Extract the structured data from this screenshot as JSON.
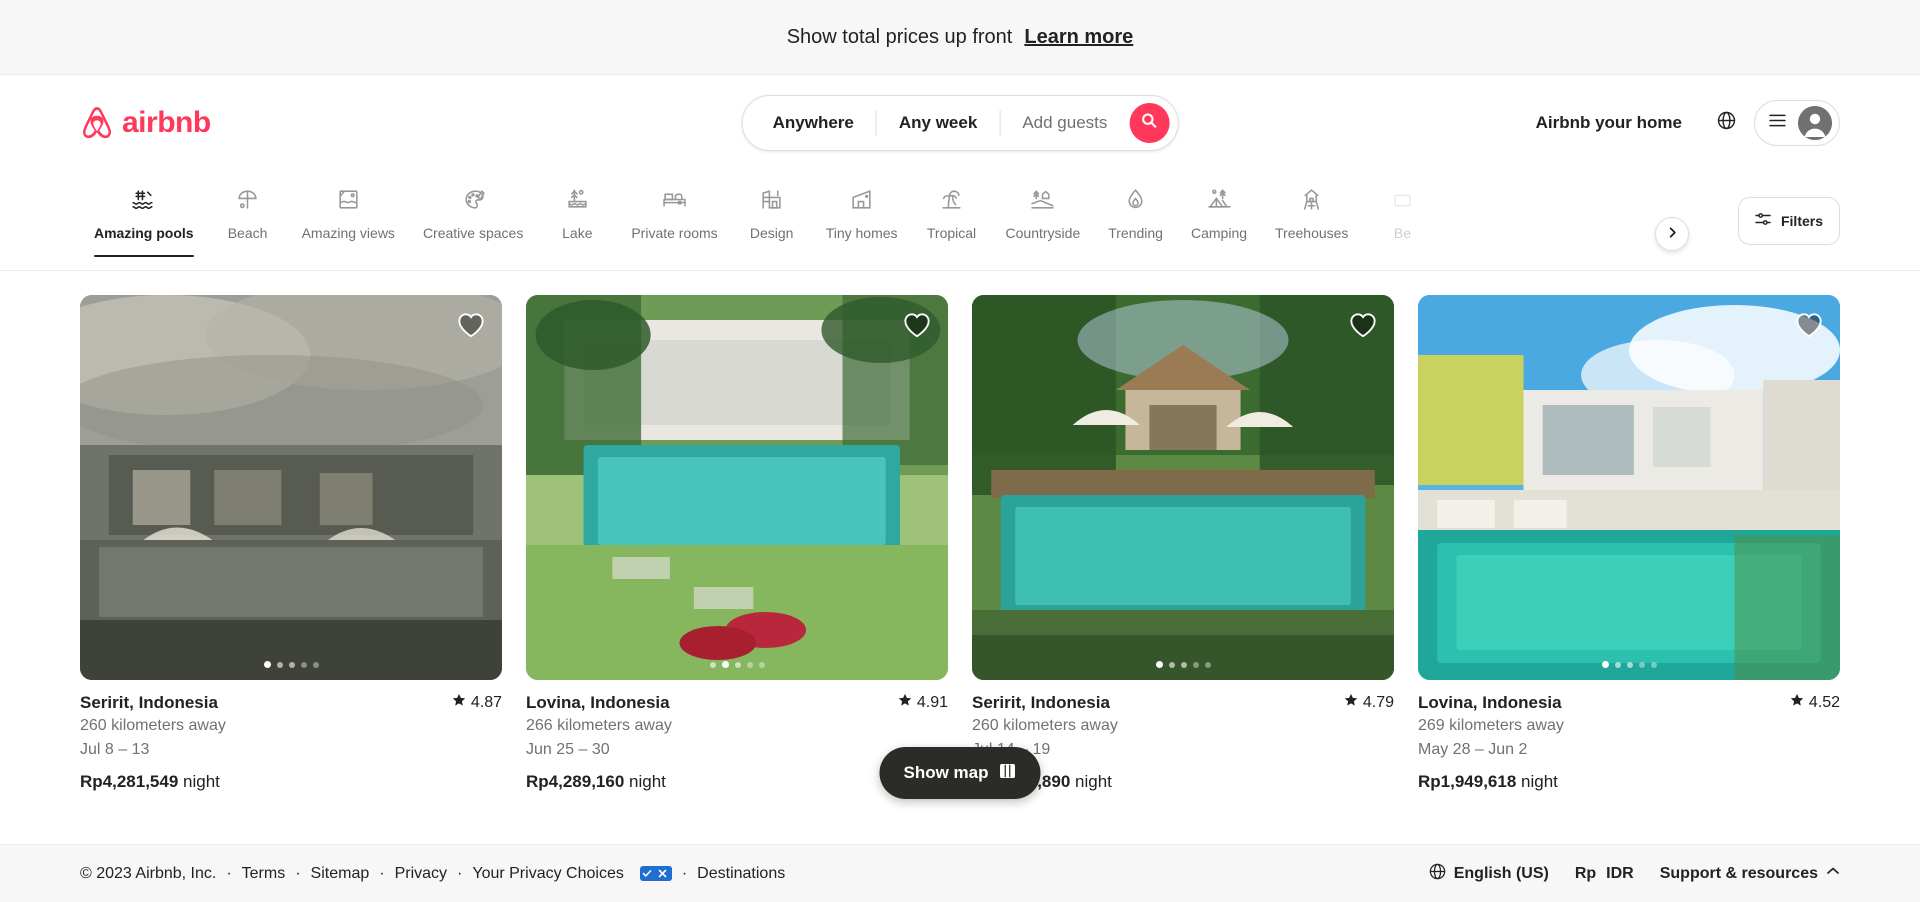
{
  "banner": {
    "text": "Show total prices up front",
    "link_label": "Learn more"
  },
  "header": {
    "logo_text": "airbnb",
    "logo_icon": "airbnb-logo-icon",
    "brand_color": "#FF385C",
    "search": {
      "where_label": "Anywhere",
      "when_label": "Any week",
      "guests_placeholder": "Add guests",
      "search_icon": "search-icon"
    },
    "host_link": "Airbnb your home",
    "globe_icon": "globe-icon",
    "menu_icon": "hamburger-menu-icon",
    "avatar_icon": "user-avatar-icon"
  },
  "categories": {
    "items": [
      {
        "label": "Amazing pools",
        "icon": "amazing-pools-icon",
        "active": true
      },
      {
        "label": "Beach",
        "icon": "beach-umbrella-icon",
        "active": false
      },
      {
        "label": "Amazing views",
        "icon": "amazing-views-icon",
        "active": false
      },
      {
        "label": "Creative spaces",
        "icon": "palette-icon",
        "active": false
      },
      {
        "label": "Lake",
        "icon": "lake-icon",
        "active": false
      },
      {
        "label": "Private rooms",
        "icon": "bed-icon",
        "active": false
      },
      {
        "label": "Design",
        "icon": "design-building-icon",
        "active": false
      },
      {
        "label": "Tiny homes",
        "icon": "tiny-home-icon",
        "active": false
      },
      {
        "label": "Tropical",
        "icon": "palm-tree-icon",
        "active": false
      },
      {
        "label": "Countryside",
        "icon": "countryside-icon",
        "active": false
      },
      {
        "label": "Trending",
        "icon": "flame-icon",
        "active": false
      },
      {
        "label": "Camping",
        "icon": "tent-icon",
        "active": false
      },
      {
        "label": "Treehouses",
        "icon": "treehouse-icon",
        "active": false
      },
      {
        "label": "Be",
        "icon": "partial-icon",
        "active": false
      }
    ],
    "next_icon": "chevron-right-icon",
    "filters_label": "Filters",
    "filters_icon": "filters-sliders-icon"
  },
  "listings": [
    {
      "title": "Seririt, Indonesia",
      "distance": "260 kilometers away",
      "dates": "Jul 8 – 13",
      "price_amount": "Rp4,281,549",
      "price_unit": "night",
      "rating": "4.87",
      "star_icon": "star-icon",
      "favorite_icon": "heart-icon",
      "photo_count": 5,
      "active_photo": 1
    },
    {
      "title": "Lovina, Indonesia",
      "distance": "266 kilometers away",
      "dates": "Jun 25 – 30",
      "price_amount": "Rp4,289,160",
      "price_unit": "night",
      "rating": "4.91",
      "star_icon": "star-icon",
      "favorite_icon": "heart-icon",
      "photo_count": 5,
      "active_photo": 2
    },
    {
      "title": "Seririt, Indonesia",
      "distance": "260 kilometers away",
      "dates": "Jul 14 – 19",
      "price_amount": "Rp1,835,890",
      "price_unit": "night",
      "rating": "4.79",
      "star_icon": "star-icon",
      "favorite_icon": "heart-icon",
      "photo_count": 5,
      "active_photo": 1
    },
    {
      "title": "Lovina, Indonesia",
      "distance": "269 kilometers away",
      "dates": "May 28 – Jun 2",
      "price_amount": "Rp1,949,618",
      "price_unit": "night",
      "rating": "4.52",
      "star_icon": "star-icon",
      "favorite_icon": "heart-icon",
      "photo_count": 5,
      "active_photo": 1
    }
  ],
  "show_map": {
    "label": "Show map",
    "icon": "map-icon"
  },
  "footer": {
    "copyright": "© 2023 Airbnb, Inc.",
    "links": [
      "Terms",
      "Sitemap",
      "Privacy",
      "Your Privacy Choices",
      "Destinations"
    ],
    "privacy_badge_icon": "privacy-choices-icon",
    "language": "English (US)",
    "currency_symbol": "Rp",
    "currency_code": "IDR",
    "support_label": "Support & resources",
    "globe_icon": "globe-icon",
    "chevron_up_icon": "chevron-up-icon"
  }
}
